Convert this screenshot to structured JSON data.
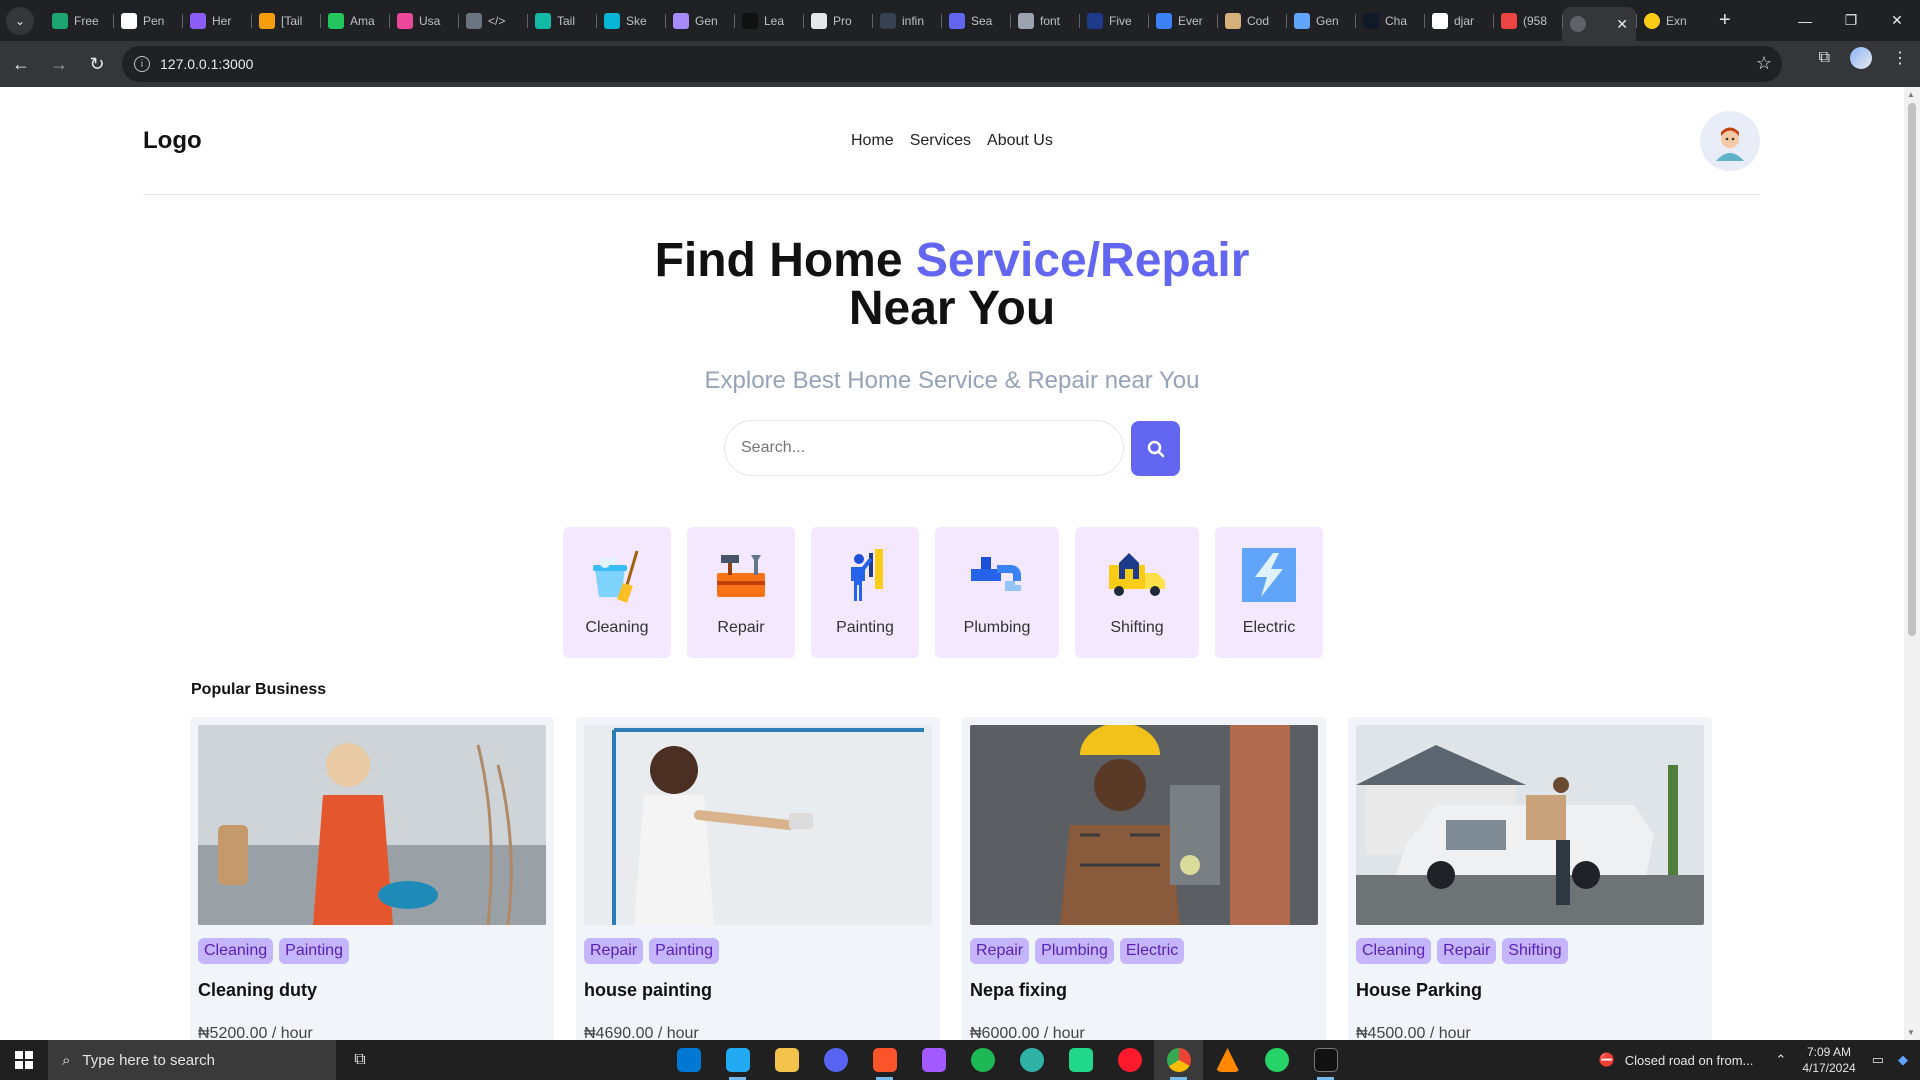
{
  "browser": {
    "tabs": [
      {
        "label": "Free",
        "color": "#1ea672"
      },
      {
        "label": "Pen",
        "color": "#ffffff"
      },
      {
        "label": "Her",
        "color": "#8b5cf6"
      },
      {
        "label": "[Tail",
        "color": "#f59e0b"
      },
      {
        "label": "Ama",
        "color": "#22c55e"
      },
      {
        "label": "Usa",
        "color": "#ec4899"
      },
      {
        "label": "</>",
        "color": "#6b7280"
      },
      {
        "label": "Tail",
        "color": "#14b8a6"
      },
      {
        "label": "Ske",
        "color": "#06b6d4"
      },
      {
        "label": "Gen",
        "color": "#a78bfa"
      },
      {
        "label": "Lea",
        "color": "#111111"
      },
      {
        "label": "Pro",
        "color": "#e5e7eb"
      },
      {
        "label": "infin",
        "color": "#374151"
      },
      {
        "label": "Sea",
        "color": "#6366f1"
      },
      {
        "label": "font",
        "color": "#9ca3af"
      },
      {
        "label": "Five",
        "color": "#1e3a8a"
      },
      {
        "label": "Ever",
        "color": "#3b82f6"
      },
      {
        "label": "Cod",
        "color": "#d6b27a"
      },
      {
        "label": "Gen",
        "color": "#60a5fa"
      },
      {
        "label": "Cha",
        "color": "#111827"
      },
      {
        "label": "djar",
        "color": "#ffffff"
      },
      {
        "label": "(958",
        "color": "#ef4444"
      }
    ],
    "active_tab": {
      "label": "",
      "color": "#5f6368"
    },
    "after_active_tab": {
      "label": "Exn",
      "color": "#facc15"
    },
    "url": "127.0.0.1:3000"
  },
  "site": {
    "logo": "Logo",
    "nav": [
      "Home",
      "Services",
      "About Us"
    ],
    "hero": {
      "title_part1": "Find Home ",
      "title_accent": "Service/Repair",
      "title_part2": "Near You",
      "subtitle": "Explore Best Home Service & Repair near You"
    },
    "search": {
      "placeholder": "Search..."
    },
    "categories": [
      {
        "label": "Cleaning",
        "icon": "cleaning-bucket-icon"
      },
      {
        "label": "Repair",
        "icon": "toolbox-icon"
      },
      {
        "label": "Painting",
        "icon": "painter-icon"
      },
      {
        "label": "Plumbing",
        "icon": "faucet-icon"
      },
      {
        "label": "Shifting",
        "icon": "moving-truck-icon"
      },
      {
        "label": "Electric",
        "icon": "lightning-icon"
      }
    ],
    "popular_title": "Popular Business",
    "businesses": [
      {
        "tags": [
          "Cleaning",
          "Painting"
        ],
        "title": "Cleaning duty",
        "price": "₦5200.00 / hour"
      },
      {
        "tags": [
          "Repair",
          "Painting"
        ],
        "title": "house painting",
        "price": "₦4690.00 / hour"
      },
      {
        "tags": [
          "Repair",
          "Plumbing",
          "Electric"
        ],
        "title": "Nepa fixing",
        "price": "₦6000.00 / hour"
      },
      {
        "tags": [
          "Cleaning",
          "Repair",
          "Shifting"
        ],
        "title": "House Parking",
        "price": "₦4500.00 / hour"
      }
    ]
  },
  "taskbar": {
    "search_placeholder": "Type here to search",
    "news": "Closed road on from...",
    "time": "7:09 AM",
    "date": "4/17/2024"
  }
}
